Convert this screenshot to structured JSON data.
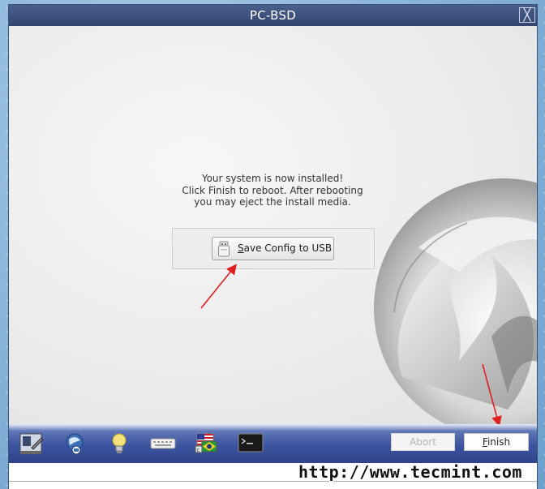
{
  "window": {
    "title": "PC-BSD",
    "close_glyph": "╳"
  },
  "message": {
    "line1": "Your system is now installed!",
    "line2": "Click Finish to reboot. After rebooting",
    "line3": "you may eject the install media."
  },
  "usb": {
    "label_accel": "S",
    "label_rest": "ave Config to USB",
    "icon": "usb-drive-icon"
  },
  "taskbar": {
    "icons": [
      "system-tools-icon",
      "network-globe-icon",
      "lightbulb-icon",
      "keyboard-icon",
      "language-flag-icon",
      "terminal-icon"
    ],
    "abort_label": "Abort",
    "finish_label_accel": "F",
    "finish_label_rest": "inish"
  },
  "watermark": "http://www.tecmint.com",
  "colors": {
    "titlebar": "#3b4f7b",
    "taskbar": "#3c54a0",
    "arrow": "#e02020"
  }
}
